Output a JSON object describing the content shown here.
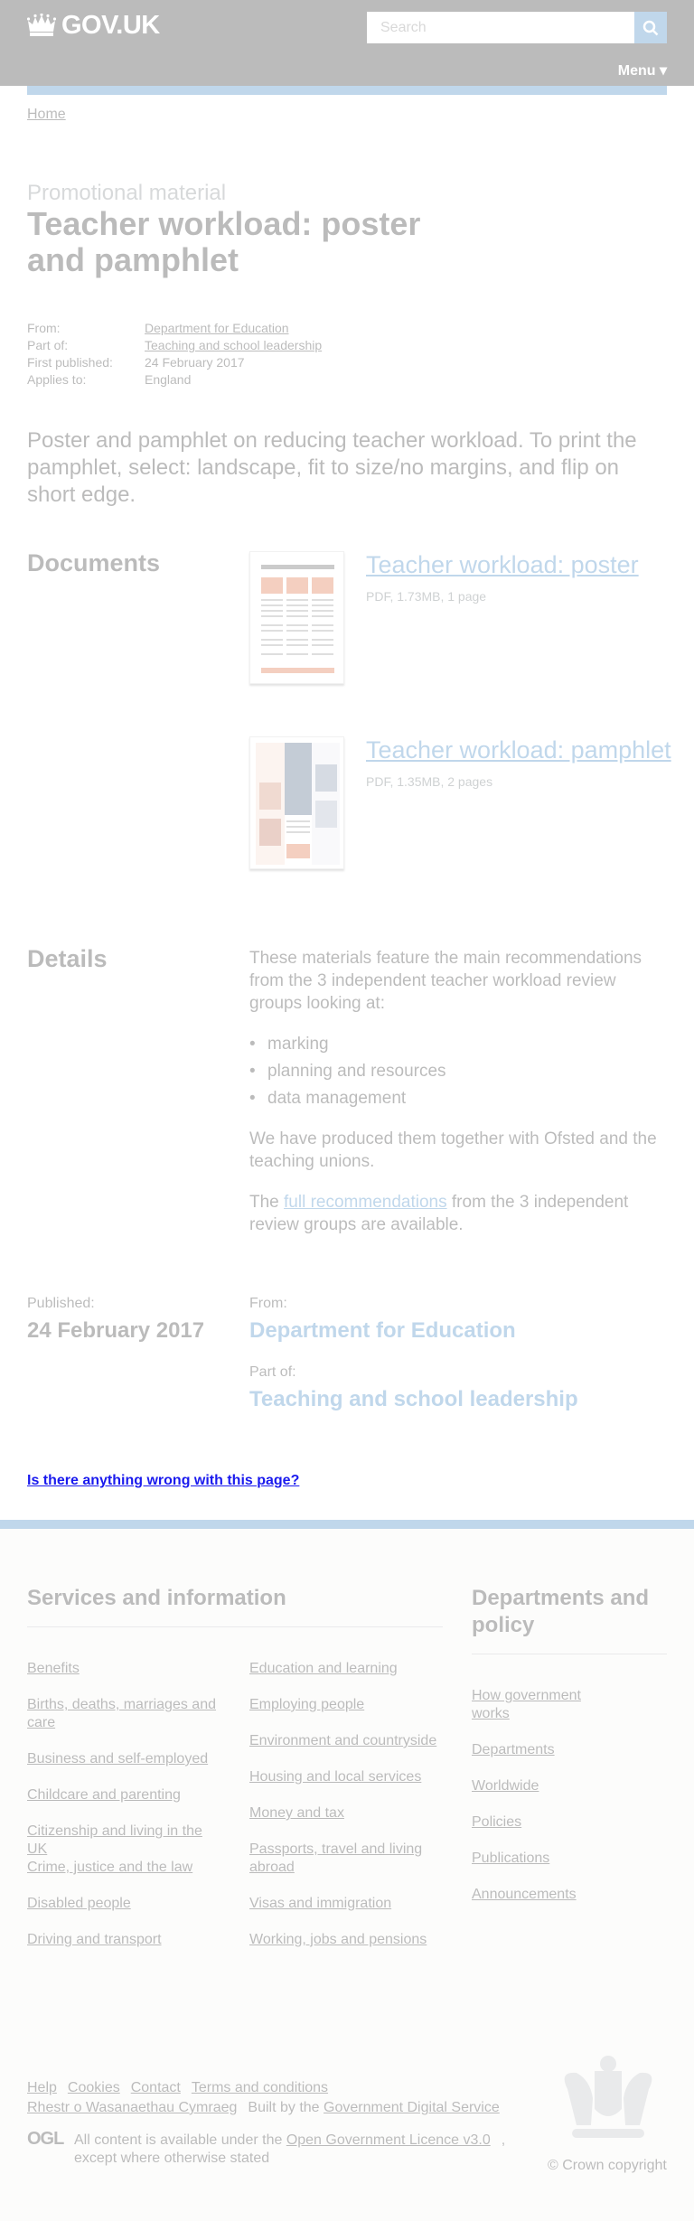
{
  "header": {
    "logo_text": "GOV.UK",
    "search_placeholder": "Search",
    "menu_label": "Menu ▾"
  },
  "breadcrumb": {
    "home": "Home"
  },
  "page": {
    "caption": "Promotional material",
    "title": "Teacher workload: poster and pamphlet",
    "meta": {
      "from_label": "From:",
      "from_value": "Department for Education",
      "part_label": "Part of:",
      "part_value": "Teaching and school leadership",
      "published_label": "First published:",
      "published_value": "24 February 2017",
      "applies_label": "Applies to:",
      "applies_value": "England"
    },
    "description": "Poster and pamphlet on reducing teacher workload. To print the pamphlet, select: landscape, fit to size/no margins, and flip on short edge."
  },
  "documents": {
    "heading": "Documents",
    "items": [
      {
        "title": "Teacher workload: poster",
        "meta": "PDF, 1.73MB, 1 page"
      },
      {
        "title": "Teacher workload: pamphlet",
        "meta": "PDF, 1.35MB, 2 pages"
      }
    ]
  },
  "details": {
    "heading": "Details",
    "intro": "These materials feature the main recommendations from the 3 independent teacher workload review groups looking at:",
    "bullets": [
      "marking",
      "planning and resources",
      "data management"
    ],
    "para2": "We have produced them together with Ofsted and the teaching unions.",
    "para3_pre": "The ",
    "para3_link": "full recommendations",
    "para3_post": " from the 3 independent review groups are available."
  },
  "publication": {
    "published_label": "Published:",
    "published_value": "24 February 2017",
    "from_label": "From:",
    "from_value": "Department for Education",
    "part_label": "Part of:",
    "part_value": "Teaching and school leadership"
  },
  "feedback": {
    "link": "Is there anything wrong with this page?"
  },
  "footer": {
    "services_heading": "Services and information",
    "services_col1": [
      "Benefits",
      "Births, deaths, marriages and care",
      "Business and self-employed",
      "Childcare and parenting",
      "Citizenship and living in the UK",
      "Crime, justice and the law",
      "Disabled people",
      "Driving and transport"
    ],
    "services_col2": [
      "Education and learning",
      "Employing people",
      "Environment and countryside",
      "Housing and local services",
      "Money and tax",
      "Passports, travel and living abroad",
      "Visas and immigration",
      "Working, jobs and pensions"
    ],
    "departments_heading": "Departments and policy",
    "departments": [
      "How government works",
      "Departments",
      "Worldwide",
      "Policies",
      "Publications",
      "Announcements"
    ],
    "meta_links": [
      "Help",
      "Cookies",
      "Contact",
      "Terms and conditions"
    ],
    "welsh_link": "Rhestr o Wasanaethau Cymraeg",
    "built_by_pre": "Built by the ",
    "built_by_link": "Government Digital Service",
    "ogl_logo": "OGL",
    "licence_pre": "All content is available under the ",
    "licence_link": "Open Government Licence v3.0",
    "licence_post": ", except where otherwise stated",
    "copyright": "© Crown copyright"
  },
  "colors": {
    "header_bg": "#0b0c0c",
    "link": "#1d70b8",
    "footer_bg": "#f3f2f1",
    "overlay": "rgba(255,255,255,0.72)"
  }
}
